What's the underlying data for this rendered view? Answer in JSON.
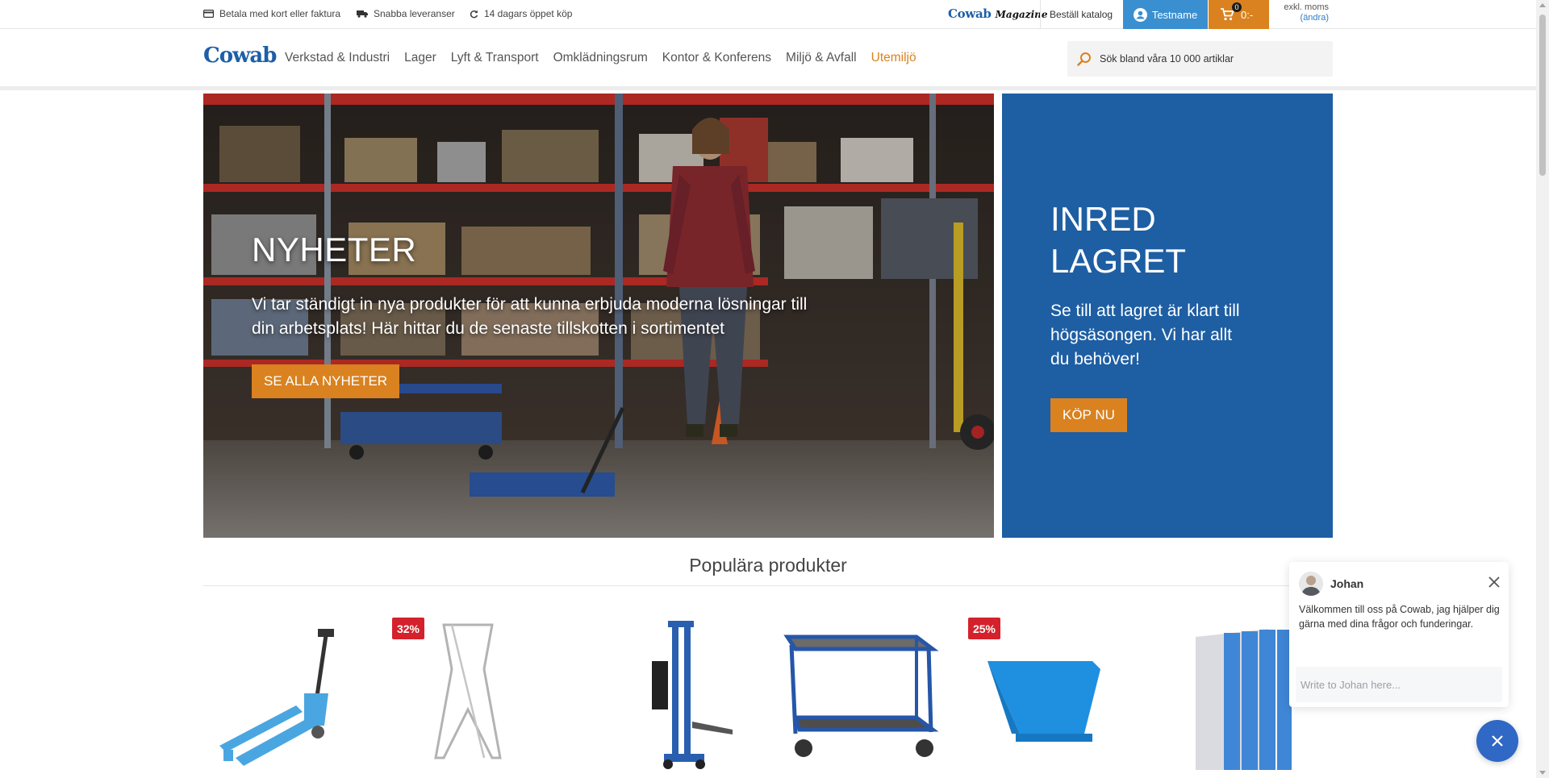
{
  "topbar": {
    "usps": [
      {
        "icon": "card-icon",
        "label": "Betala med kort eller faktura"
      },
      {
        "icon": "truck-icon",
        "label": "Snabba leveranser"
      },
      {
        "icon": "refresh-icon",
        "label": "14 dagars öppet köp"
      }
    ],
    "magazine_brand": "Cowab",
    "magazine_word": "Magazine",
    "catalog_link": "Beställ katalog",
    "user_label": "Testname",
    "cart_count": "0",
    "cart_total": "0:-",
    "vat_label": "exkl. moms",
    "vat_change": "(ändra)"
  },
  "header": {
    "logo": "Cowab",
    "nav": [
      {
        "label": "Verkstad & Industri",
        "highlight": false
      },
      {
        "label": "Lager",
        "highlight": false
      },
      {
        "label": "Lyft & Transport",
        "highlight": false
      },
      {
        "label": "Omklädningsrum",
        "highlight": false
      },
      {
        "label": "Kontor & Konferens",
        "highlight": false
      },
      {
        "label": "Miljö & Avfall",
        "highlight": false
      },
      {
        "label": "Utemiljö",
        "highlight": true
      }
    ],
    "search_placeholder": "Sök bland våra 10 000 artiklar"
  },
  "hero": {
    "title": "NYHETER",
    "text": "Vi tar ständigt in nya produkter för att kunna erbjuda moderna lösningar till din arbetsplats! Här hittar du de senaste tillskotten i sortimentet",
    "button": "SE ALLA NYHETER"
  },
  "side_banner": {
    "title": "INRED LAGRET",
    "text": "Se till att lagret är klart till högsäsongen. Vi har allt du behöver!",
    "button": "KÖP NU"
  },
  "popular": {
    "title": "Populära produkter",
    "products": [
      {
        "name": "pallet-truck",
        "badge": ""
      },
      {
        "name": "foldable-frame",
        "badge": "32%"
      },
      {
        "name": "manual-stacker",
        "badge": ""
      },
      {
        "name": "trolley",
        "badge": ""
      },
      {
        "name": "tipping-skip",
        "badge": "25%"
      },
      {
        "name": "locker",
        "badge": ""
      }
    ]
  },
  "chat": {
    "agent_name": "Johan",
    "message": "Välkommen till oss på Cowab, jag hjälper dig gärna med dina frågor och funderingar.",
    "input_placeholder": "Write to Johan here..."
  },
  "colors": {
    "brand_blue": "#1d5fa8",
    "accent_orange": "#d9821f",
    "user_blue": "#3a8fd0",
    "banner_blue": "#1e5ea3",
    "sale_red": "#d4212b"
  }
}
